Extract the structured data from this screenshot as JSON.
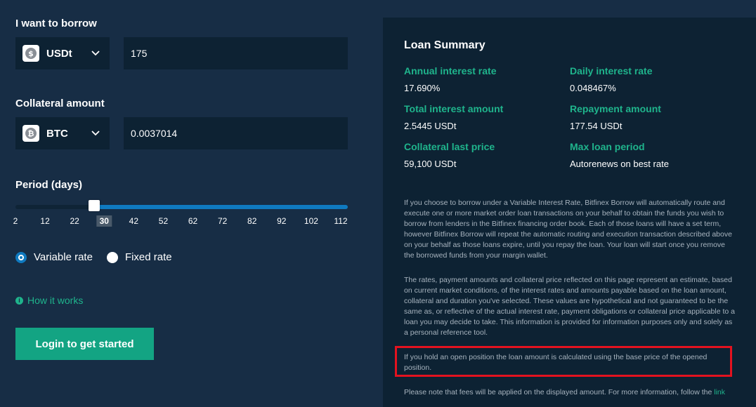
{
  "borrow": {
    "label": "I want to borrow",
    "currency": "USDt",
    "currency_icon": "usdt-coin-icon",
    "amount": "175"
  },
  "collateral": {
    "label": "Collateral amount",
    "currency": "BTC",
    "currency_icon": "btc-coin-icon",
    "amount": "0.0037014"
  },
  "period": {
    "label": "Period (days)",
    "ticks": [
      "2",
      "12",
      "22",
      "30",
      "42",
      "52",
      "62",
      "72",
      "82",
      "92",
      "102",
      "112"
    ],
    "selected": "30",
    "selected_fraction": 0.236
  },
  "rate_options": {
    "variable": "Variable rate",
    "fixed": "Fixed rate",
    "selected": "variable"
  },
  "how_it_works": "How it works",
  "cta_label": "Login to get started",
  "summary": {
    "title": "Loan Summary",
    "stats": [
      {
        "label": "Annual interest rate",
        "value": "17.690%"
      },
      {
        "label": "Daily interest rate",
        "value": "0.048467%"
      },
      {
        "label": "Total interest amount",
        "value": "2.5445 USDt"
      },
      {
        "label": "Repayment amount",
        "value": "177.54 USDt"
      },
      {
        "label": "Collateral last price",
        "value": "59,100 USDt"
      },
      {
        "label": "Max loan period",
        "value": "Autorenews on best rate"
      }
    ],
    "para1": "If you choose to borrow under a Variable Interest Rate, Bitfinex Borrow will automatically route and execute one or more market order loan transactions on your behalf to obtain the funds you wish to borrow from lenders in the Bitfinex financing order book. Each of those loans will have a set term, however Bitfinex Borrow will repeat the automatic routing and execution transaction described above on your behalf as those loans expire, until you repay the loan. Your loan will start once you remove the borrowed funds from your margin wallet.",
    "para2": "The rates, payment amounts and collateral price reflected on this page represent an estimate, based on current market conditions, of the interest rates and amounts payable based on the loan amount, collateral and duration you've selected. These values are hypothetical and not guaranteed to be the same as, or reflective of the actual interest rate, payment obligations or collateral price applicable to a loan you may decide to take. This information is provided for information purposes only and solely as a personal reference tool.",
    "para3": "If you hold an open position the loan amount is calculated using the base price of the opened position.",
    "para4": "Please note that fees will be applied on the displayed amount. For more information, follow the",
    "para4_link": "link"
  },
  "colors": {
    "background": "#172d45",
    "panel": "#0d2233",
    "accent_green": "#1fb48c",
    "button_green": "#13a483",
    "slider_blue": "#0f7ac0",
    "highlight_red": "#e3121f"
  }
}
